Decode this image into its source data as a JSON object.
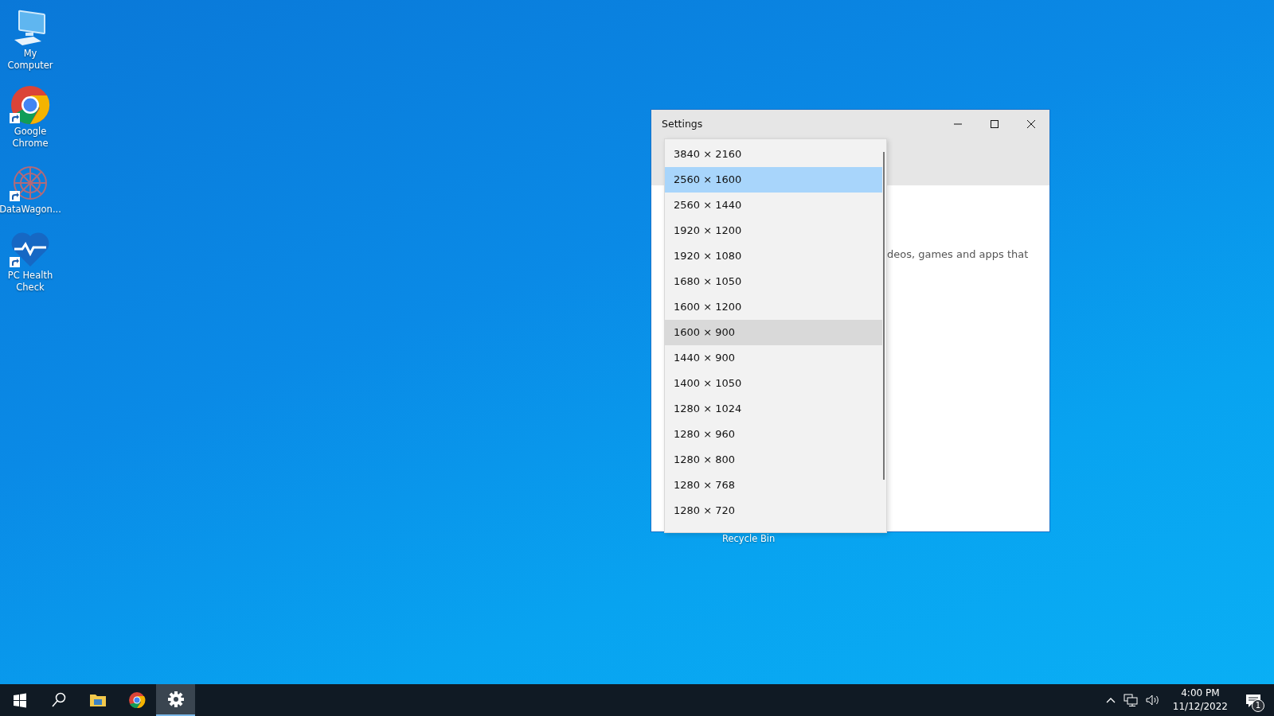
{
  "desktop_icons": [
    {
      "kind": "computer",
      "label": "My Computer",
      "shortcut": false
    },
    {
      "kind": "chrome",
      "label": "Google Chrome",
      "shortcut": true
    },
    {
      "kind": "datawagon",
      "label": "DataWagon...",
      "shortcut": true
    },
    {
      "kind": "health",
      "label": "PC Health Check",
      "shortcut": true
    }
  ],
  "window": {
    "title": "Settings",
    "body_text": "deos, games and apps that",
    "dropdown": {
      "options": [
        {
          "label": "3840 × 2160",
          "selected": false,
          "hovered": false
        },
        {
          "label": "2560 × 1600",
          "selected": true,
          "hovered": false
        },
        {
          "label": "2560 × 1440",
          "selected": false,
          "hovered": false
        },
        {
          "label": "1920 × 1200",
          "selected": false,
          "hovered": false
        },
        {
          "label": "1920 × 1080",
          "selected": false,
          "hovered": false
        },
        {
          "label": "1680 × 1050",
          "selected": false,
          "hovered": false
        },
        {
          "label": "1600 × 1200",
          "selected": false,
          "hovered": false
        },
        {
          "label": "1600 × 900",
          "selected": false,
          "hovered": true
        },
        {
          "label": "1440 × 900",
          "selected": false,
          "hovered": false
        },
        {
          "label": "1400 × 1050",
          "selected": false,
          "hovered": false
        },
        {
          "label": "1280 × 1024",
          "selected": false,
          "hovered": false
        },
        {
          "label": "1280 × 960",
          "selected": false,
          "hovered": false
        },
        {
          "label": "1280 × 800",
          "selected": false,
          "hovered": false
        },
        {
          "label": "1280 × 768",
          "selected": false,
          "hovered": false
        },
        {
          "label": "1280 × 720",
          "selected": false,
          "hovered": false
        }
      ]
    }
  },
  "desktop_label_peek": "Recycle Bin",
  "taskbar": {
    "items": [
      {
        "kind": "start",
        "active": false
      },
      {
        "kind": "search",
        "active": false
      },
      {
        "kind": "explorer",
        "active": false
      },
      {
        "kind": "chrome",
        "active": false
      },
      {
        "kind": "settings",
        "active": true
      }
    ],
    "time": "4:00 PM",
    "date": "11/12/2022",
    "notification_count": "1"
  }
}
